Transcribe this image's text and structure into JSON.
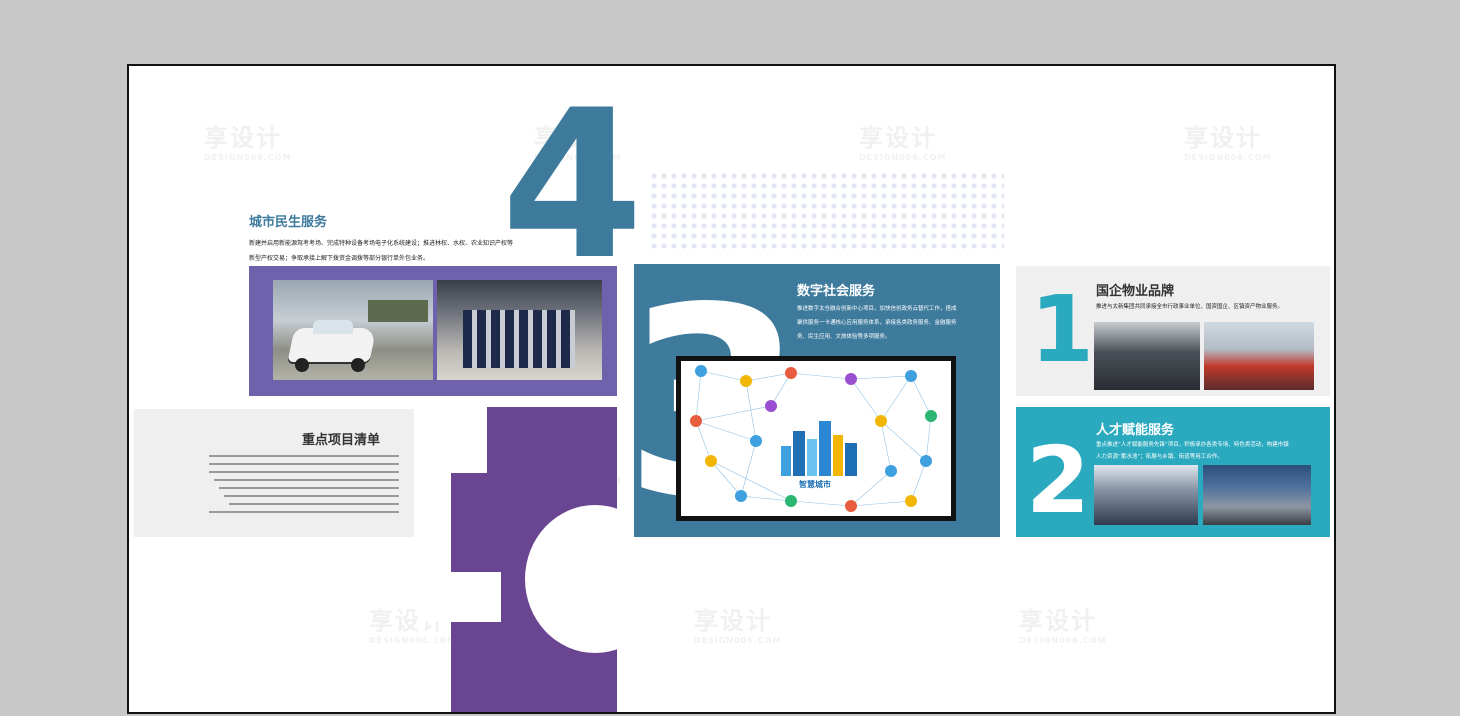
{
  "watermark": {
    "text": "享设计",
    "sub": "DESIGN006.COM"
  },
  "sections": {
    "s4": {
      "number": "4",
      "title": "城市民生服务",
      "desc_line1": "新建并启用新能源驾考考场、完成特种设备考场电子化系统建设；推进林权、水权、农业知识产权等",
      "desc_line2": "新型产权交易；争取承接上解下拨资金调拨等部分银行单外包业务。"
    },
    "s3": {
      "number": "3",
      "title": "数字社会服务",
      "desc_line1": "推进数字太仓融合创新中心项目，加快信创政务云替代工作，搭成",
      "desc_line2": "聚供服务一卡通核心应用服务体系，承接各类政务服务、金融服务",
      "desc_line3": "务、民生应用、文旅体验等多项服务。",
      "diagram_label": "智慧城市"
    },
    "s1": {
      "number": "1",
      "title": "国企物业品牌",
      "desc": "推进与太新集团共同承接全市行政事业单位、国资国企、区镇资产物业服务。"
    },
    "s2": {
      "number": "2",
      "title": "人才赋能服务",
      "desc_line1": "重点推进“人才赋能服务先锋”项目，积极承办各类专场、特色类活动，构建市镇",
      "desc_line2": "人力资源“蓄水池”；拓展与乡镇、街道等用工合作。"
    },
    "s5": {
      "number": "5",
      "title": "重点项目清单"
    }
  },
  "colors": {
    "blue": "#3d7a9c",
    "purple": "#6a4591",
    "teal": "#2ba9bf",
    "gray": "#efefef"
  }
}
